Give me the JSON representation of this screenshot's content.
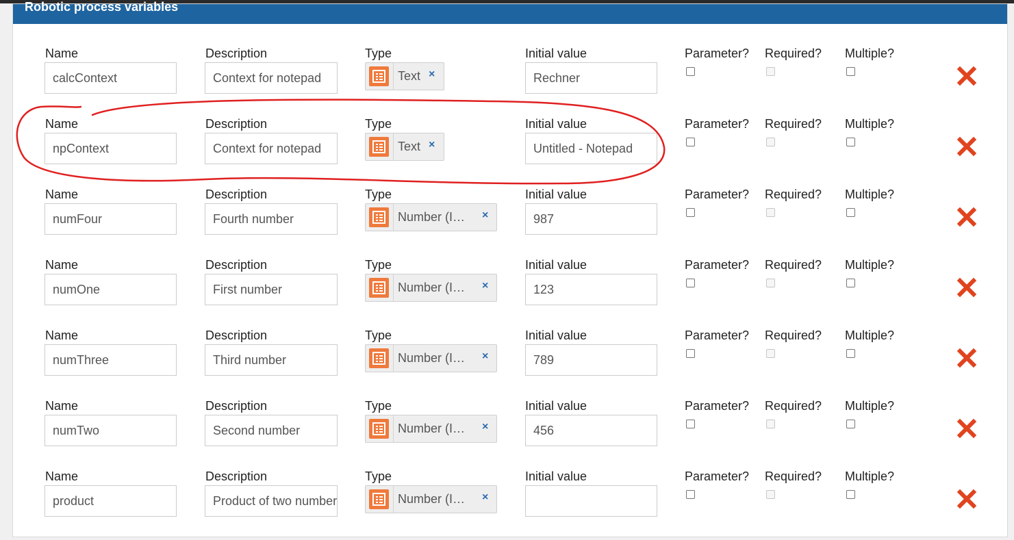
{
  "panel": {
    "title": "Robotic process variables"
  },
  "labels": {
    "name": "Name",
    "description": "Description",
    "type": "Type",
    "initial_value": "Initial value",
    "parameter": "Parameter?",
    "required": "Required?",
    "multiple": "Multiple?"
  },
  "variables": [
    {
      "name": "calcContext",
      "description": "Context for notepad",
      "type": "Text",
      "initial_value": "Rechner",
      "parameter": false,
      "required": false,
      "multiple": false
    },
    {
      "name": "npContext",
      "description": "Context for notepad",
      "type": "Text",
      "initial_value": "Untitled - Notepad",
      "parameter": false,
      "required": false,
      "multiple": false
    },
    {
      "name": "numFour",
      "description": "Fourth number",
      "type": "Number (I…",
      "initial_value": "987",
      "parameter": false,
      "required": false,
      "multiple": false
    },
    {
      "name": "numOne",
      "description": "First number",
      "type": "Number (I…",
      "initial_value": "123",
      "parameter": false,
      "required": false,
      "multiple": false
    },
    {
      "name": "numThree",
      "description": "Third number",
      "type": "Number (I…",
      "initial_value": "789",
      "parameter": false,
      "required": false,
      "multiple": false
    },
    {
      "name": "numTwo",
      "description": "Second number",
      "type": "Number (I…",
      "initial_value": "456",
      "parameter": false,
      "required": false,
      "multiple": false
    },
    {
      "name": "product",
      "description": "Product of two numbers",
      "type": "Number (I…",
      "initial_value": "",
      "parameter": false,
      "required": false,
      "multiple": false
    }
  ],
  "icons": {
    "type": "type-list-icon",
    "remove_type": "close-icon",
    "delete_row": "delete-x-icon"
  },
  "colors": {
    "header": "#1e64a0",
    "type_icon": "#ef7a3c",
    "delete": "#e0441f",
    "annotation": "#e02020"
  }
}
